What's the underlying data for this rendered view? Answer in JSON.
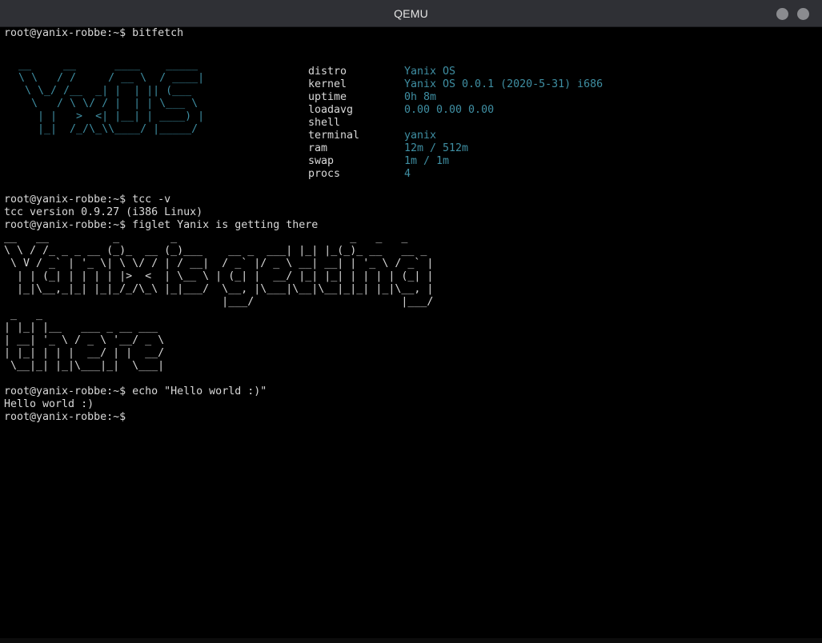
{
  "window": {
    "title": "QEMU"
  },
  "terminal": {
    "prompt": "root@yanix-robbe:~$",
    "cmd_bitfetch": " bitfetch",
    "logo_lines": [
      " __     __      ____    _____ ",
      " \\ \\   / /     / __ \\  / ____|",
      "  \\ \\_/ /__  _| |  | || (___  ",
      "   \\   / \\ \\/ / |  | | \\___ \\ ",
      "    | |   >  <| |__| | ____) |",
      "    |_|  /_/\\_\\\\____/ |_____/ "
    ],
    "info": [
      {
        "key": "distro",
        "value": "Yanix OS"
      },
      {
        "key": "kernel",
        "value": "Yanix OS 0.0.1 (2020-5-31) i686"
      },
      {
        "key": "uptime",
        "value": "0h 8m"
      },
      {
        "key": "loadavg",
        "value": "0.00 0.00 0.00"
      },
      {
        "key": "shell",
        "value": ""
      },
      {
        "key": "terminal",
        "value": "yanix"
      },
      {
        "key": "ram",
        "value": "12m / 512m"
      },
      {
        "key": "swap",
        "value": "1m / 1m"
      },
      {
        "key": "procs",
        "value": "4"
      }
    ],
    "cmd_tcc": " tcc -v",
    "tcc_output": "tcc version 0.9.27 (i386 Linux)",
    "cmd_figlet": " figlet Yanix is getting there",
    "figlet_lines": [
      "__   __          _        _                           _   _   _             ",
      "\\ \\ / /_ _ _ __ (_)_  __ (_)___    __ _  ___| |_| |_(_)_ __   __ _ ",
      " \\ V / _` | '_ \\| \\ \\/ / | / __|  / _` |/ _ \\ __| __| | '_ \\ / _` |",
      "  | | (_| | | | | |>  <  | \\__ \\ | (_| |  __/ |_| |_| | | | | (_| |",
      "  |_|\\__,_|_| |_|_/_/\\_\\ |_|___/  \\__, |\\___|\\__|\\__|_|_| |_|\\__, |",
      "                                  |___/                       |___/ ",
      " _   _                   ",
      "| |_| |__   ___ _ __ ___ ",
      "| __| '_ \\ / _ \\ '__/ _ \\",
      "| |_| | | |  __/ | |  __/",
      " \\__|_| |_|\\___|_|  \\___|"
    ],
    "cmd_echo": " echo \"Hello world :)\"",
    "echo_output": "Hello world :)",
    "final_prompt": "root@yanix-robbe:~$"
  },
  "colors": {
    "accent_blue": "#3f8fa3",
    "text_gray": "#d9d9d9",
    "titlebar": "#2f3035"
  }
}
